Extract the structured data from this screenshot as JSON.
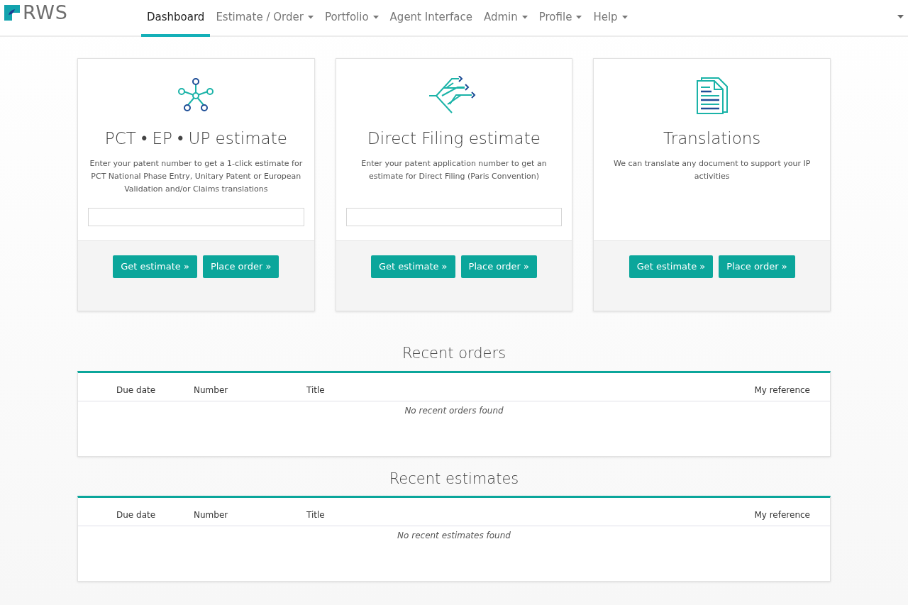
{
  "logo": {
    "text": "RWS"
  },
  "nav": [
    {
      "label": "Dashboard",
      "selected": true,
      "dropdown": false
    },
    {
      "label": "Estimate / Order",
      "selected": false,
      "dropdown": true
    },
    {
      "label": "Portfolio",
      "selected": false,
      "dropdown": true
    },
    {
      "label": "Agent Interface",
      "selected": false,
      "dropdown": false
    },
    {
      "label": "Admin",
      "selected": false,
      "dropdown": true
    },
    {
      "label": "Profile",
      "selected": false,
      "dropdown": true
    },
    {
      "label": "Help",
      "selected": false,
      "dropdown": true
    }
  ],
  "cards": [
    {
      "kind": "network",
      "title": "PCT • EP • UP estimate",
      "description": "Enter your patent number to get a 1-click estimate for PCT National Phase Entry, Unitary Patent or European Validation and/or Claims translations",
      "has_input": true,
      "buttons": [
        "Get estimate »",
        "Place order »"
      ]
    },
    {
      "kind": "filing",
      "title": "Direct Filing estimate",
      "description": "Enter your patent application number to get an estimate for Direct Filing (Paris Convention)",
      "has_input": true,
      "buttons": [
        "Get estimate »",
        "Place order »"
      ]
    },
    {
      "kind": "document",
      "title": "Translations",
      "description": "We can translate any document to support your IP activities",
      "has_input": false,
      "buttons": [
        "Get estimate »",
        "Place order »"
      ]
    }
  ],
  "tables": [
    {
      "title": "Recent orders",
      "columns": [
        "Due date",
        "Number",
        "Title",
        "My reference"
      ],
      "empty_message": "No recent orders found"
    },
    {
      "title": "Recent estimates",
      "columns": [
        "Due date",
        "Number",
        "Title",
        "My reference"
      ],
      "empty_message": "No recent estimates found"
    }
  ]
}
